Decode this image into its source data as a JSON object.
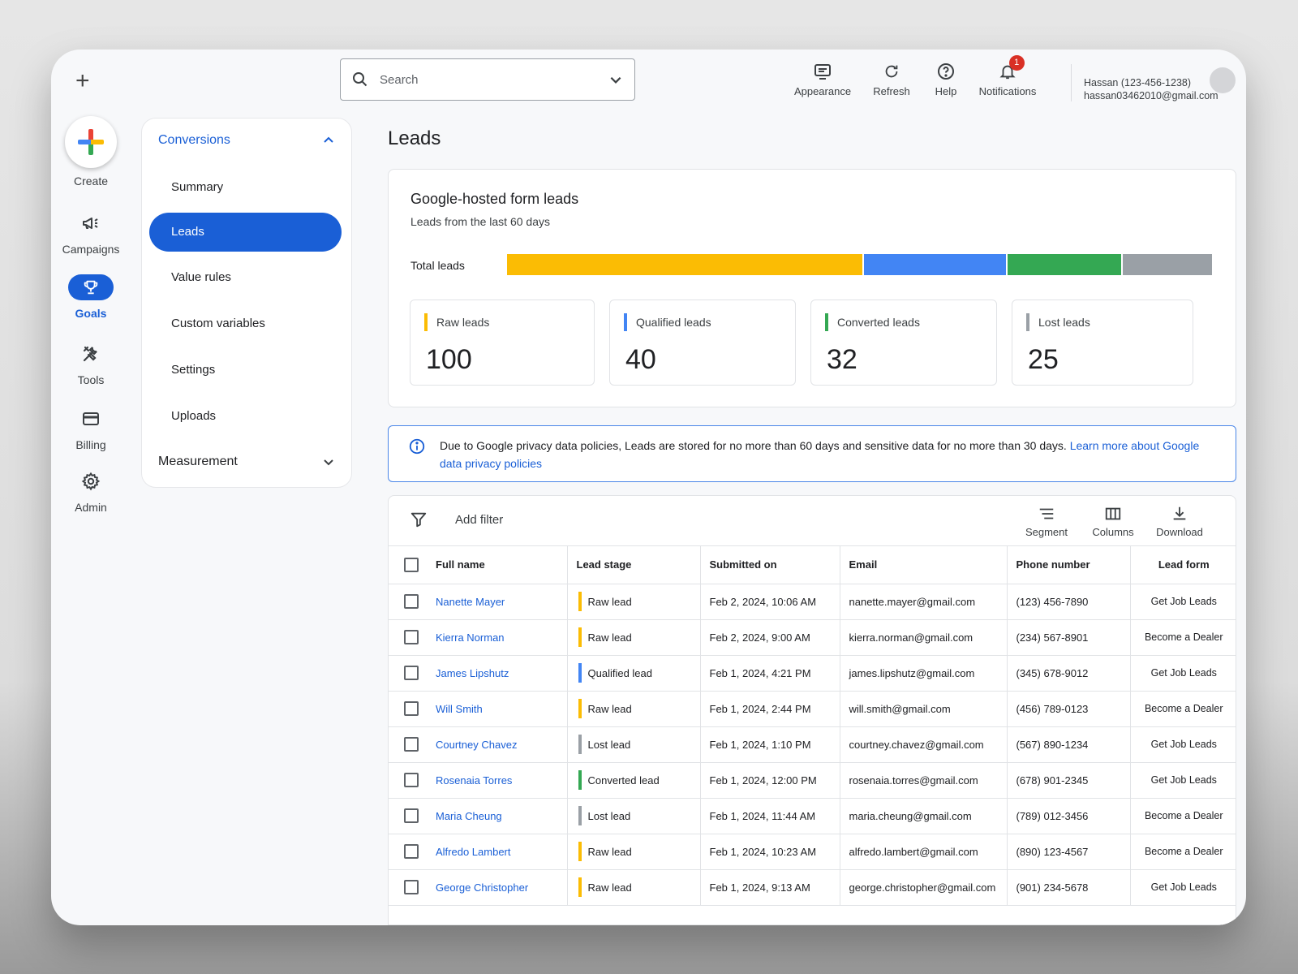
{
  "rail": {
    "create_label": "Create",
    "items": [
      {
        "label": "Campaigns",
        "icon": "megaphone-icon"
      },
      {
        "label": "Goals",
        "icon": "trophy-icon",
        "active": true
      },
      {
        "label": "Tools",
        "icon": "tools-icon"
      },
      {
        "label": "Billing",
        "icon": "credit-card-icon"
      },
      {
        "label": "Admin",
        "icon": "gear-icon"
      }
    ]
  },
  "subnav": {
    "section_open": "Conversions",
    "items": [
      "Summary",
      "Leads",
      "Value rules",
      "Custom variables",
      "Settings",
      "Uploads"
    ],
    "active_item": "Leads",
    "section_closed": "Measurement"
  },
  "search": {
    "placeholder": "Search"
  },
  "top_actions": [
    {
      "label": "Appearance",
      "icon": "appearance-icon"
    },
    {
      "label": "Refresh",
      "icon": "refresh-icon"
    },
    {
      "label": "Help",
      "icon": "help-icon"
    },
    {
      "label": "Notifications",
      "icon": "bell-icon",
      "badge": "1"
    }
  ],
  "account": {
    "name": "Hassan (123-456-1238)",
    "email": "hassan03462010@gmail.com"
  },
  "page_title": "Leads",
  "summary": {
    "title": "Google-hosted form leads",
    "subtitle": "Leads from the last 60 days",
    "total_label": "Total leads",
    "stats": [
      {
        "label": "Raw leads",
        "value": "100",
        "color": "#fbbc04"
      },
      {
        "label": "Qualified leads",
        "value": "40",
        "color": "#4285f4"
      },
      {
        "label": "Converted leads",
        "value": "32",
        "color": "#34a853"
      },
      {
        "label": "Lost leads",
        "value": "25",
        "color": "#9aa0a6"
      }
    ]
  },
  "info": {
    "text": "Due to Google privacy data policies, Leads are stored for no more than 60 days and sensitive data for no more than 30 days. ",
    "link": "Learn more about Google data privacy policies"
  },
  "toolbar": {
    "add_filter": "Add filter",
    "segment": "Segment",
    "columns": "Columns",
    "download": "Download"
  },
  "table": {
    "headers": [
      "Full name",
      "Lead stage",
      "Submitted on",
      "Email",
      "Phone number",
      "Lead form"
    ],
    "rows": [
      {
        "name": "Nanette Mayer",
        "stage": "Raw lead",
        "stage_color": "#fbbc04",
        "submitted": "Feb 2, 2024, 10:06 AM",
        "email": "nanette.mayer@gmail.com",
        "phone": "(123) 456-7890",
        "form": "Get Job Leads"
      },
      {
        "name": "Kierra Norman",
        "stage": "Raw lead",
        "stage_color": "#fbbc04",
        "submitted": "Feb 2, 2024, 9:00 AM",
        "email": "kierra.norman@gmail.com",
        "phone": "(234) 567-8901",
        "form": "Become a Dealer"
      },
      {
        "name": "James Lipshutz",
        "stage": "Qualified lead",
        "stage_color": "#4285f4",
        "submitted": "Feb 1, 2024, 4:21 PM",
        "email": "james.lipshutz@gmail.com",
        "phone": "(345) 678-9012",
        "form": "Get Job Leads"
      },
      {
        "name": "Will Smith",
        "stage": "Raw lead",
        "stage_color": "#fbbc04",
        "submitted": "Feb 1, 2024, 2:44 PM",
        "email": "will.smith@gmail.com",
        "phone": "(456) 789-0123",
        "form": "Become a Dealer"
      },
      {
        "name": "Courtney Chavez",
        "stage": "Lost lead",
        "stage_color": "#9aa0a6",
        "submitted": "Feb 1, 2024, 1:10 PM",
        "email": "courtney.chavez@gmail.com",
        "phone": "(567) 890-1234",
        "form": "Get Job Leads"
      },
      {
        "name": "Rosenaia Torres",
        "stage": "Converted lead",
        "stage_color": "#34a853",
        "submitted": "Feb 1, 2024, 12:00 PM",
        "email": "rosenaia.torres@gmail.com",
        "phone": "(678) 901-2345",
        "form": "Get Job Leads"
      },
      {
        "name": "Maria Cheung",
        "stage": "Lost lead",
        "stage_color": "#9aa0a6",
        "submitted": "Feb 1, 2024, 11:44 AM",
        "email": "maria.cheung@gmail.com",
        "phone": "(789) 012-3456",
        "form": "Become a Dealer"
      },
      {
        "name": "Alfredo Lambert",
        "stage": "Raw lead",
        "stage_color": "#fbbc04",
        "submitted": "Feb 1, 2024, 10:23 AM",
        "email": "alfredo.lambert@gmail.com",
        "phone": "(890) 123-4567",
        "form": "Become a Dealer"
      },
      {
        "name": "George Christopher",
        "stage": "Raw lead",
        "stage_color": "#fbbc04",
        "submitted": "Feb 1, 2024, 9:13 AM",
        "email": "george.christopher@gmail.com",
        "phone": "(901) 234-5678",
        "form": "Get Job Leads"
      }
    ]
  },
  "colors": {
    "accent": "#1a5fd6",
    "raw": "#fbbc04",
    "qualified": "#4285f4",
    "converted": "#34a853",
    "lost": "#9aa0a6",
    "badge": "#d93025"
  }
}
